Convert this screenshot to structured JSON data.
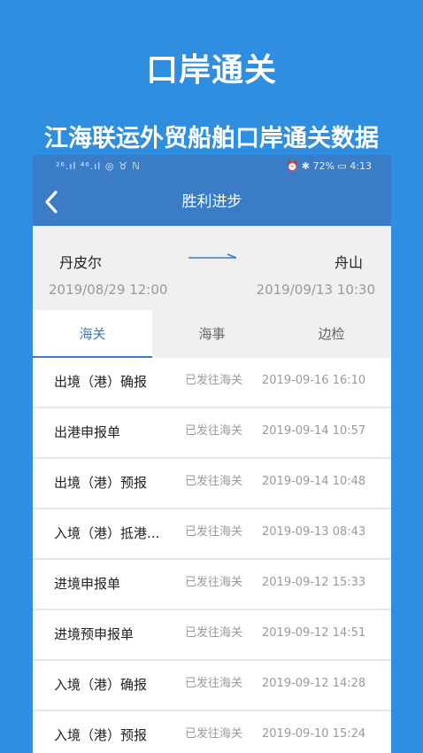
{
  "promo": {
    "title": "口岸通关",
    "subtitle": "江海联运外贸船舶口岸通关数据"
  },
  "status_bar": {
    "left": "²⁶.ıl ⁴⁶.ıl ◎ ♉ ℕ",
    "right": "⏰ ✱ 72% ▭ 4:13",
    "battery": "72%",
    "time": "4:13"
  },
  "nav": {
    "title": "胜利进步",
    "back_icon": "chevron-left-icon"
  },
  "route": {
    "from_port": "丹皮尔",
    "to_port": "舟山",
    "from_time": "2019/08/29 12:00",
    "to_time": "2019/09/13 10:30",
    "arrow_icon": "right-arrow-icon"
  },
  "tabs": [
    {
      "label": "海关",
      "active": true
    },
    {
      "label": "海事",
      "active": false
    },
    {
      "label": "边检",
      "active": false
    }
  ],
  "records": [
    {
      "title": "出境（港）确报",
      "status": "已发往海关",
      "time": "2019-09-16 16:10"
    },
    {
      "title": "出港申报单",
      "status": "已发往海关",
      "time": "2019-09-14 10:57"
    },
    {
      "title": "出境（港）预报",
      "status": "已发往海关",
      "time": "2019-09-14 10:48"
    },
    {
      "title": "入境（港）抵港...",
      "status": "已发往海关",
      "time": "2019-09-13 08:43"
    },
    {
      "title": "进境申报单",
      "status": "已发往海关",
      "time": "2019-09-12 15:33"
    },
    {
      "title": "进境预申报单",
      "status": "已发往海关",
      "time": "2019-09-12 14:51"
    },
    {
      "title": "入境（港）确报",
      "status": "已发往海关",
      "time": "2019-09-12 14:28"
    },
    {
      "title": "入境（港）预报",
      "status": "已发往海关",
      "time": "2019-09-10 15:24"
    }
  ],
  "colors": {
    "background": "#2f8ee0",
    "header": "#3a7cc6",
    "accent": "#3a7cc6"
  }
}
